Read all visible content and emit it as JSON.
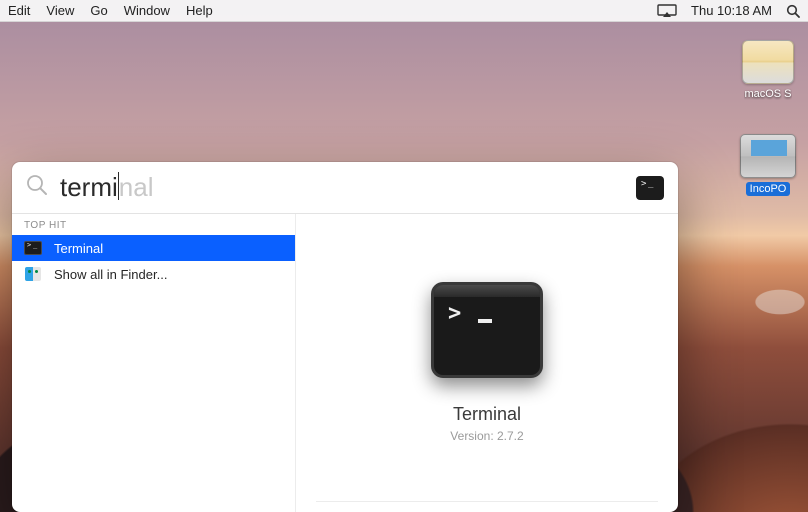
{
  "menubar": {
    "items": [
      "Edit",
      "View",
      "Go",
      "Window",
      "Help"
    ],
    "clock": "Thu 10:18 AM"
  },
  "desktop": {
    "icons": [
      {
        "label": "macOS S",
        "selected": false
      },
      {
        "label": "IncoPO",
        "selected": true
      }
    ]
  },
  "spotlight": {
    "typed": "termi",
    "completion_rest": "nal",
    "section_label": "TOP HIT",
    "results": [
      {
        "icon": "terminal",
        "label": "Terminal",
        "selected": true
      },
      {
        "icon": "finder",
        "label": "Show all in Finder...",
        "selected": false
      }
    ],
    "preview": {
      "name": "Terminal",
      "version_label": "Version: 2.7.2"
    }
  }
}
